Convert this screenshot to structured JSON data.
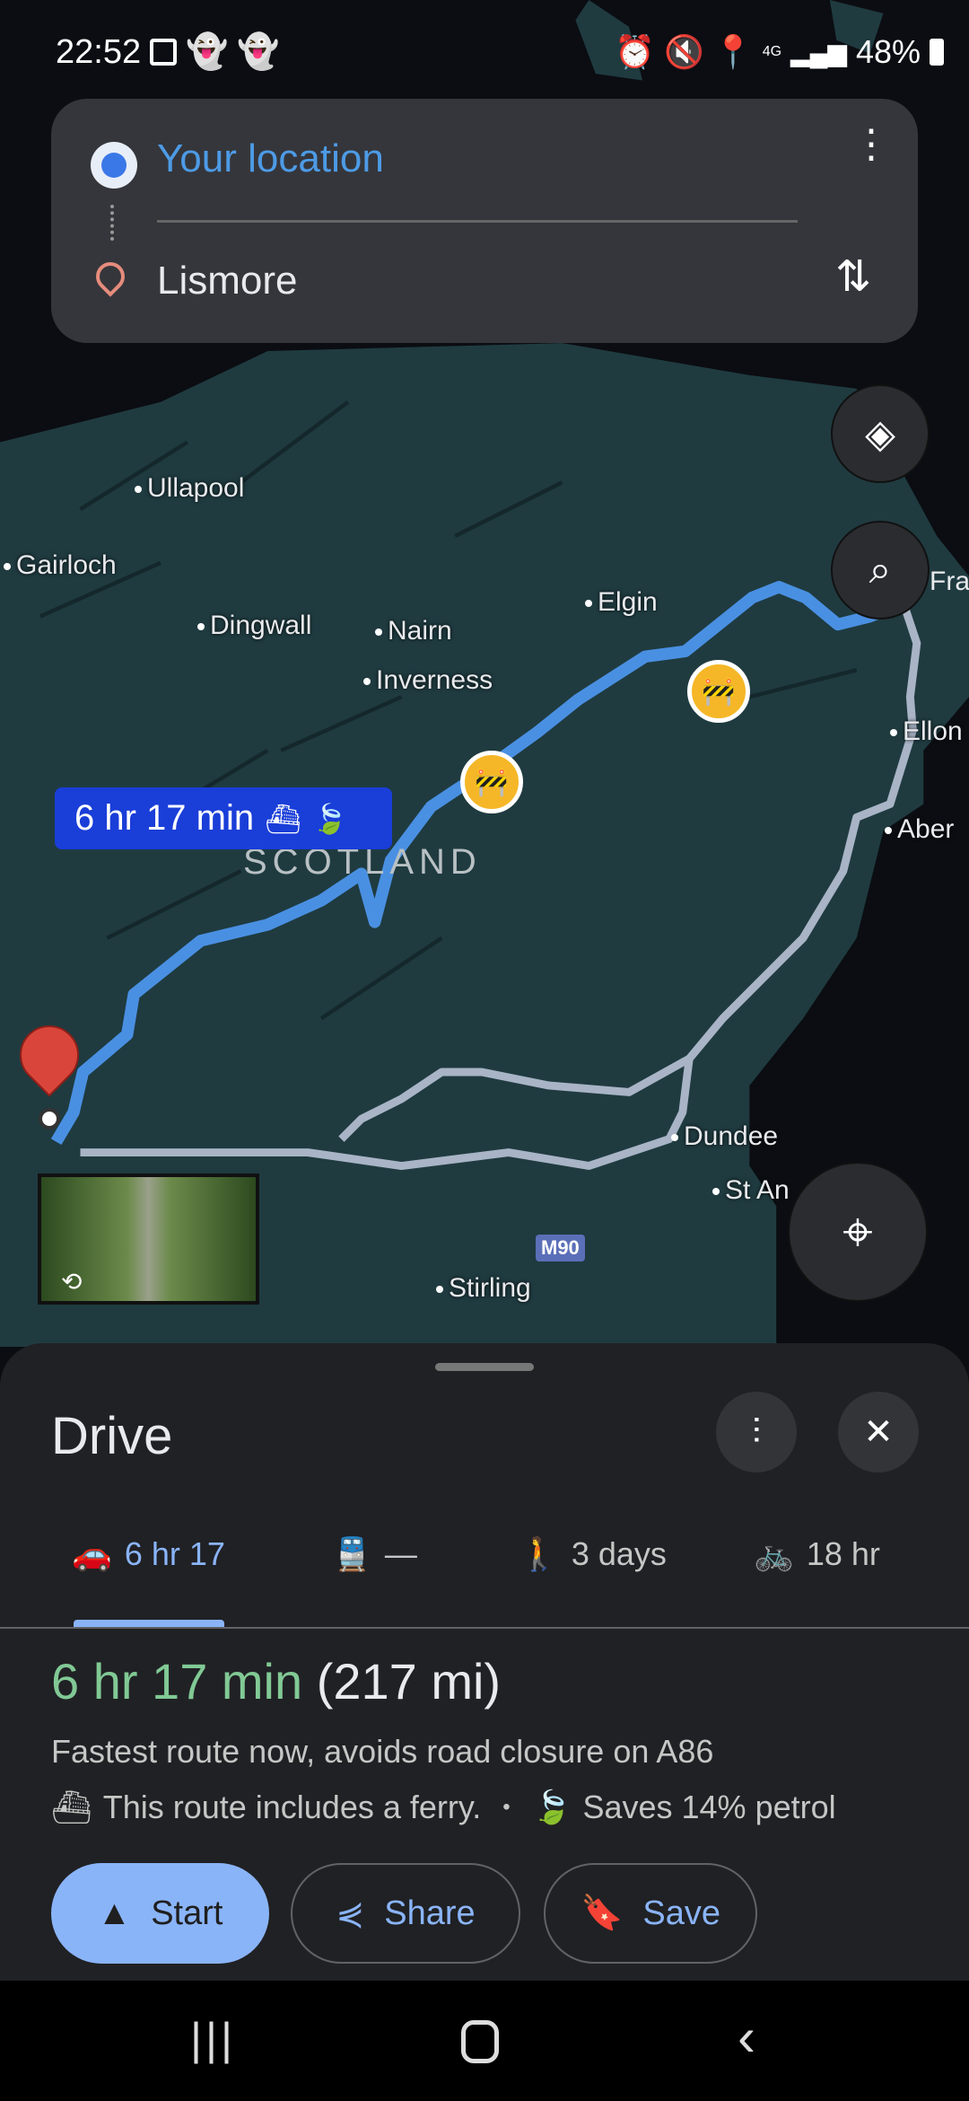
{
  "status_bar": {
    "time": "22:52",
    "battery": "48%",
    "network": "4G",
    "icons": [
      "gallery-icon",
      "snapchat-icon",
      "snapchat-icon",
      "alarm-icon",
      "mute-icon",
      "location-icon",
      "signal-icon",
      "battery-icon"
    ]
  },
  "search": {
    "origin": "Your location",
    "destination": "Lismore"
  },
  "map": {
    "places": [
      "Ullapool",
      "Gairloch",
      "Dingwall",
      "Nairn",
      "Inverness",
      "Elgin",
      "Ellon",
      "Aber",
      "Dundee",
      "St An",
      "Stirling",
      "Fras"
    ],
    "region": "SCOTLAND",
    "road_badge": "M90",
    "route_label": "6 hr 17 min",
    "colors": {
      "land": "#1f3b40",
      "water": "#0b0d12",
      "route_primary": "#4a90e2",
      "route_alt": "#a9b4c6",
      "route_label_bg": "#1a3ed8"
    }
  },
  "sheet": {
    "title": "Drive",
    "tabs": [
      {
        "mode": "drive",
        "label": "6 hr 17",
        "selected": true
      },
      {
        "mode": "transit",
        "label": "—"
      },
      {
        "mode": "walk",
        "label": "3 days"
      },
      {
        "mode": "cycle",
        "label": "18 hr"
      }
    ],
    "duration": "6 hr 17 min",
    "distance": "(217 mi)",
    "description": "Fastest route now, avoids road closure on A86",
    "ferry_note": "This route includes a ferry.",
    "separator": "•",
    "eco_note": "Saves 14% petrol",
    "buttons": {
      "start": "Start",
      "share": "Share",
      "save": "Save"
    },
    "colors": {
      "accent": "#8ab4f8",
      "duration": "#81c995"
    }
  }
}
